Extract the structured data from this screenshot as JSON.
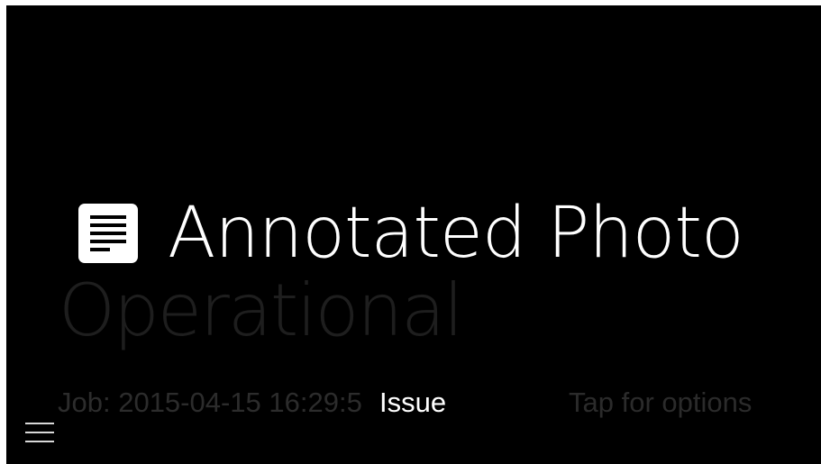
{
  "card": {
    "title": "Annotated Photo",
    "subtitle": "Operational",
    "icon": "document-icon"
  },
  "footer": {
    "job_label": "Job: 2015-04-15 16:29:5",
    "issue_label": "Issue",
    "tap_hint": "Tap for options"
  },
  "menu": {
    "icon": "menu-icon"
  },
  "colors": {
    "background": "#000000",
    "primary_text": "#ffffff",
    "dim_text": "#2c2c2c"
  }
}
